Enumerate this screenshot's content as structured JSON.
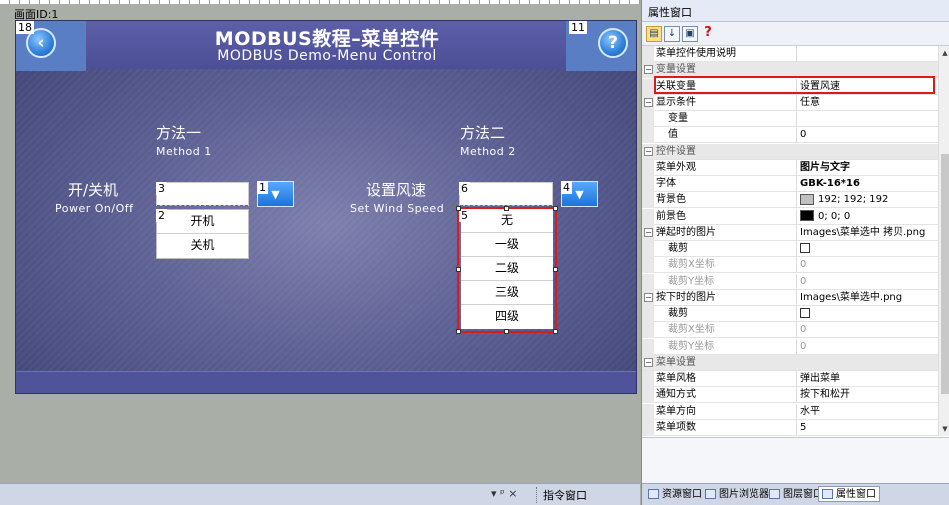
{
  "workspace": {
    "screen_label": "画面ID:1",
    "screen": {
      "title_cn": "MODBUS教程–菜单控件",
      "title_en": "MODBUS Demo-Menu Control",
      "back_id": "18",
      "help_id": "11",
      "help_glyph": "?",
      "back_glyph": "‹",
      "method1": {
        "title_cn": "方法一",
        "title_en": "Method 1",
        "label_cn": "开/关机",
        "label_en": "Power On/Off",
        "menu_head_id": "3",
        "menu_list_id": "2",
        "button_id": "1",
        "items": [
          "开机",
          "关机"
        ]
      },
      "method2": {
        "title_cn": "方法二",
        "title_en": "Method 2",
        "label_cn": "设置风速",
        "label_en": "Set Wind Speed",
        "menu_head_id": "6",
        "menu_list_id": "5",
        "button_id": "4",
        "items": [
          "无",
          "一级",
          "二级",
          "三级",
          "四级"
        ]
      }
    }
  },
  "dock": {
    "pin_controls": "▾ ᵖ ×",
    "command_tab": "指令窗口"
  },
  "properties": {
    "title": "属性窗口",
    "rows": [
      {
        "type": "prop",
        "name": "菜单控件使用说明",
        "value": ""
      },
      {
        "type": "cat",
        "name": "变量设置"
      },
      {
        "type": "prop",
        "name": "关联变量",
        "value": "设置风速"
      },
      {
        "type": "prop",
        "name": "显示条件",
        "value": "任意",
        "toggle": "−"
      },
      {
        "type": "prop",
        "name": "变量",
        "value": "",
        "indent": true
      },
      {
        "type": "prop",
        "name": "值",
        "value": "0",
        "indent": true
      },
      {
        "type": "cat",
        "name": "控件设置"
      },
      {
        "type": "prop",
        "name": "菜单外观",
        "value": "图片与文字",
        "bold": true
      },
      {
        "type": "prop",
        "name": "字体",
        "value": "GBK-16*16",
        "bold": true
      },
      {
        "type": "prop",
        "name": "背景色",
        "value": "192; 192; 192",
        "swatch": "#c0c0c0"
      },
      {
        "type": "prop",
        "name": "前景色",
        "value": "0; 0; 0",
        "swatch": "#000000"
      },
      {
        "type": "prop",
        "name": "弹起时的图片",
        "value": "Images\\菜单选中 拷贝.png",
        "toggle": "−"
      },
      {
        "type": "prop",
        "name": "裁剪",
        "value": "",
        "indent": true,
        "checkbox": true
      },
      {
        "type": "prop",
        "name": "裁剪X坐标",
        "value": "0",
        "indent": true,
        "disabled": true
      },
      {
        "type": "prop",
        "name": "裁剪Y坐标",
        "value": "0",
        "indent": true,
        "disabled": true
      },
      {
        "type": "prop",
        "name": "按下时的图片",
        "value": "Images\\菜单选中.png",
        "toggle": "−"
      },
      {
        "type": "prop",
        "name": "裁剪",
        "value": "",
        "indent": true,
        "checkbox": true
      },
      {
        "type": "prop",
        "name": "裁剪X坐标",
        "value": "0",
        "indent": true,
        "disabled": true
      },
      {
        "type": "prop",
        "name": "裁剪Y坐标",
        "value": "0",
        "indent": true,
        "disabled": true
      },
      {
        "type": "cat",
        "name": "菜单设置"
      },
      {
        "type": "prop",
        "name": "菜单风格",
        "value": "弹出菜单"
      },
      {
        "type": "prop",
        "name": "通知方式",
        "value": "按下和松开"
      },
      {
        "type": "prop",
        "name": "菜单方向",
        "value": "水平"
      },
      {
        "type": "prop",
        "name": "菜单项数",
        "value": "5"
      }
    ],
    "tabs": [
      "资源窗口",
      "图片浏览器",
      "图层窗口",
      "属性窗口"
    ],
    "active_tab": "属性窗口"
  }
}
